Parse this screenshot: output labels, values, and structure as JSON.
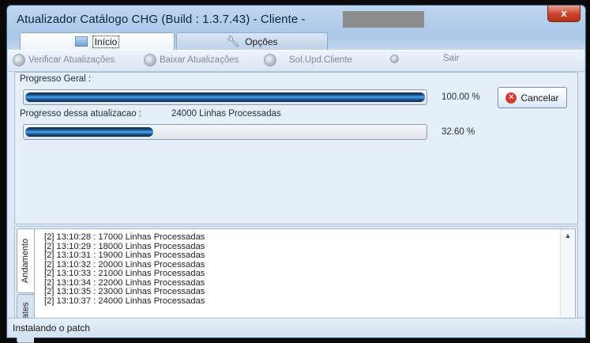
{
  "window": {
    "title": "Atualizador Catálogo CHG  (Build : 1.3.7.43) - Cliente -",
    "close_label": "x"
  },
  "main_tabs": [
    {
      "label": "Início",
      "active": true,
      "icon": "image-icon"
    },
    {
      "label": "Opções",
      "active": false,
      "icon": "wrench-icon"
    }
  ],
  "toolbar": {
    "verificar": "Verificar Atualizações",
    "baixar": "Baixar Atualizações",
    "sol_upd": "Sol.Upd.Cliente",
    "sair": "Sair"
  },
  "progress": {
    "geral_label": "Progresso Geral :",
    "geral_percent": "100.00 %",
    "geral_value": 100,
    "atual_label": "Progresso dessa atualizacao :",
    "atual_detail": "24000 Linhas Processadas",
    "atual_percent": "32.60 %",
    "atual_value": 32.6,
    "cancel_label": "Cancelar"
  },
  "side_tabs": [
    {
      "label": "Andamento",
      "active": true
    },
    {
      "label": "Updates",
      "active": false
    }
  ],
  "log": [
    "[2] 13:10:28 : 17000 Linhas Processadas",
    "[2] 13:10:29 : 18000 Linhas Processadas",
    "[2] 13:10:31 : 19000 Linhas Processadas",
    "[2] 13:10:32 : 20000 Linhas Processadas",
    "[2] 13:10:33 : 21000 Linhas Processadas",
    "[2] 13:10:34 : 22000 Linhas Processadas",
    "[2] 13:10:35 : 23000 Linhas Processadas",
    "[2] 13:10:37 : 24000 Linhas Processadas"
  ],
  "status": "Instalando o patch",
  "colors": {
    "accent": "#1d5d9a",
    "close": "#c7432b",
    "cancel_icon": "#d53b33"
  }
}
